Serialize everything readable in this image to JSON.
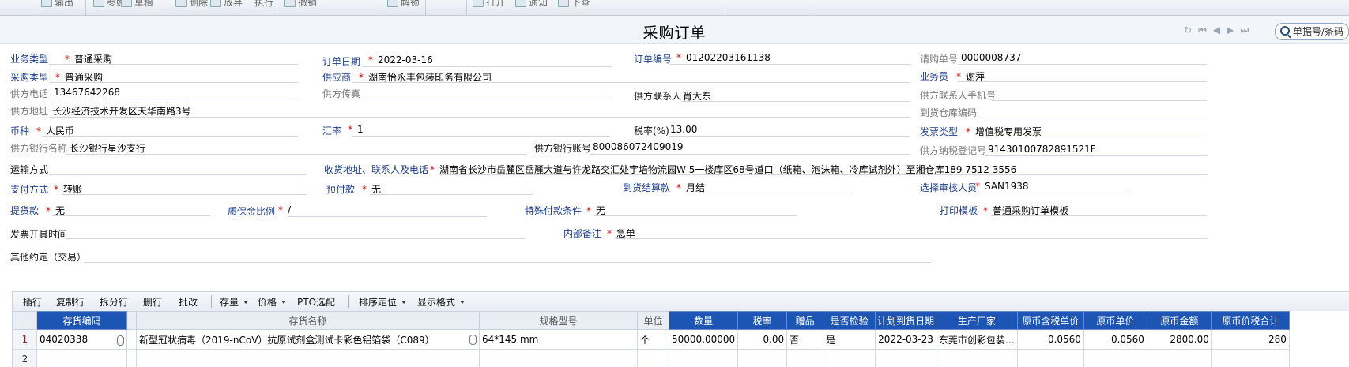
{
  "toolbar": {
    "buttons": [
      "输出",
      "参照",
      "草稿",
      "删除",
      "放弃",
      "执行",
      "撤销",
      "解锁",
      "打开",
      "通知",
      "下查"
    ]
  },
  "header": {
    "title": "采购订单",
    "search_placeholder": "单据号/条码"
  },
  "form": {
    "business_type": {
      "label": "业务类型",
      "value": "普通采购"
    },
    "order_date": {
      "label": "订单日期",
      "value": "2022-03-16"
    },
    "order_no": {
      "label": "订单编号",
      "value": "01202203161138"
    },
    "requisition_no": {
      "label": "请购单号",
      "value": "0000008737"
    },
    "purchase_type": {
      "label": "采购类型",
      "value": "普通采购"
    },
    "supplier": {
      "label": "供应商",
      "value": "湖南怡永丰包装印务有限公司"
    },
    "salesman": {
      "label": "业务员",
      "value": "谢萍"
    },
    "supplier_phone": {
      "label": "供方电话",
      "value": "13467642268"
    },
    "supplier_fax": {
      "label": "供方传真",
      "value": ""
    },
    "supplier_contact": {
      "label": "供方联系人",
      "value": "肖大东"
    },
    "supplier_contact_mobile": {
      "label": "供方联系人手机号",
      "value": ""
    },
    "supplier_address": {
      "label": "供方地址",
      "value": "长沙经济技术开发区天华南路3号"
    },
    "arrival_warehouse": {
      "label": "到货仓库编码",
      "value": ""
    },
    "currency": {
      "label": "币种",
      "value": "人民币"
    },
    "exchange_rate": {
      "label": "汇率",
      "value": "1"
    },
    "tax_rate": {
      "label": "税率(%)",
      "value": "13.00"
    },
    "invoice_type": {
      "label": "发票类型",
      "value": "增值税专用发票"
    },
    "supplier_bank": {
      "label": "供方银行名称",
      "value": "长沙银行星沙支行"
    },
    "supplier_account": {
      "label": "供方银行账号",
      "value": "800086072409019"
    },
    "supplier_tax_no": {
      "label": "供方纳税登记号",
      "value": "91430100782891521F"
    },
    "transport": {
      "label": "运输方式",
      "value": ""
    },
    "delivery_address": {
      "label": "收货地址、联系人及电话",
      "value": "湖南省长沙市岳麓区岳麓大道与许龙路交汇处宇培物流园W-5一楼库区68号道口（纸箱、泡沫箱、冷库试剂外）至湘仓库189 7512 3556"
    },
    "payment_method": {
      "label": "支付方式",
      "value": "转账"
    },
    "prepayment": {
      "label": "预付款",
      "value": "无"
    },
    "payment_on_arrival": {
      "label": "到货结算款",
      "value": "月结"
    },
    "reviewer": {
      "label": "选择审核人员",
      "value": "SAN1938"
    },
    "pickup_payment": {
      "label": "提货款",
      "value": "无"
    },
    "warranty_ratio": {
      "label": "质保金比例",
      "value": "/"
    },
    "special_terms": {
      "label": "特殊付款条件",
      "value": "无"
    },
    "print_template": {
      "label": "打印模板",
      "value": "普通采购订单模板"
    },
    "invoice_time": {
      "label": "发票开具时间",
      "value": ""
    },
    "internal_note": {
      "label": "内部备注",
      "value": "急单"
    },
    "other_terms": {
      "label": "其他约定（交易）",
      "value": ""
    }
  },
  "grid_toolbar": {
    "insert": "插行",
    "copy": "复制行",
    "split": "拆分行",
    "delete": "删行",
    "batch": "批改",
    "stock": "存量",
    "price": "价格",
    "pto": "PTO选配",
    "sort": "排序定位",
    "format": "显示格式"
  },
  "table": {
    "columns": [
      "存货编码",
      "存货名称",
      "规格型号",
      "单位",
      "数量",
      "税率",
      "赠品",
      "是否检验",
      "计划到货日期",
      "生产厂家",
      "原币含税单价",
      "原币单价",
      "原币金额",
      "原币价税合计"
    ],
    "rows": [
      {
        "no": "1",
        "code": "04020338",
        "name": "新型冠状病毒（2019-nCoV）抗原试剂盒测试卡彩色铝箔袋（C089）",
        "spec": "64*145 mm",
        "unit": "个",
        "qty": "50000.00000",
        "tax": "0.00",
        "gift": "否",
        "inspect": "是",
        "date": "2022-03-23",
        "maker": "东莞市创彩包装…",
        "tax_price": "0.0560",
        "price": "0.0560",
        "amount": "2800.00",
        "total": "280"
      },
      {
        "no": "2",
        "code": "",
        "name": "",
        "spec": "",
        "unit": "",
        "qty": "",
        "tax": "",
        "gift": "",
        "inspect": "",
        "date": "",
        "maker": "",
        "tax_price": "",
        "price": "",
        "amount": "",
        "total": ""
      }
    ]
  }
}
